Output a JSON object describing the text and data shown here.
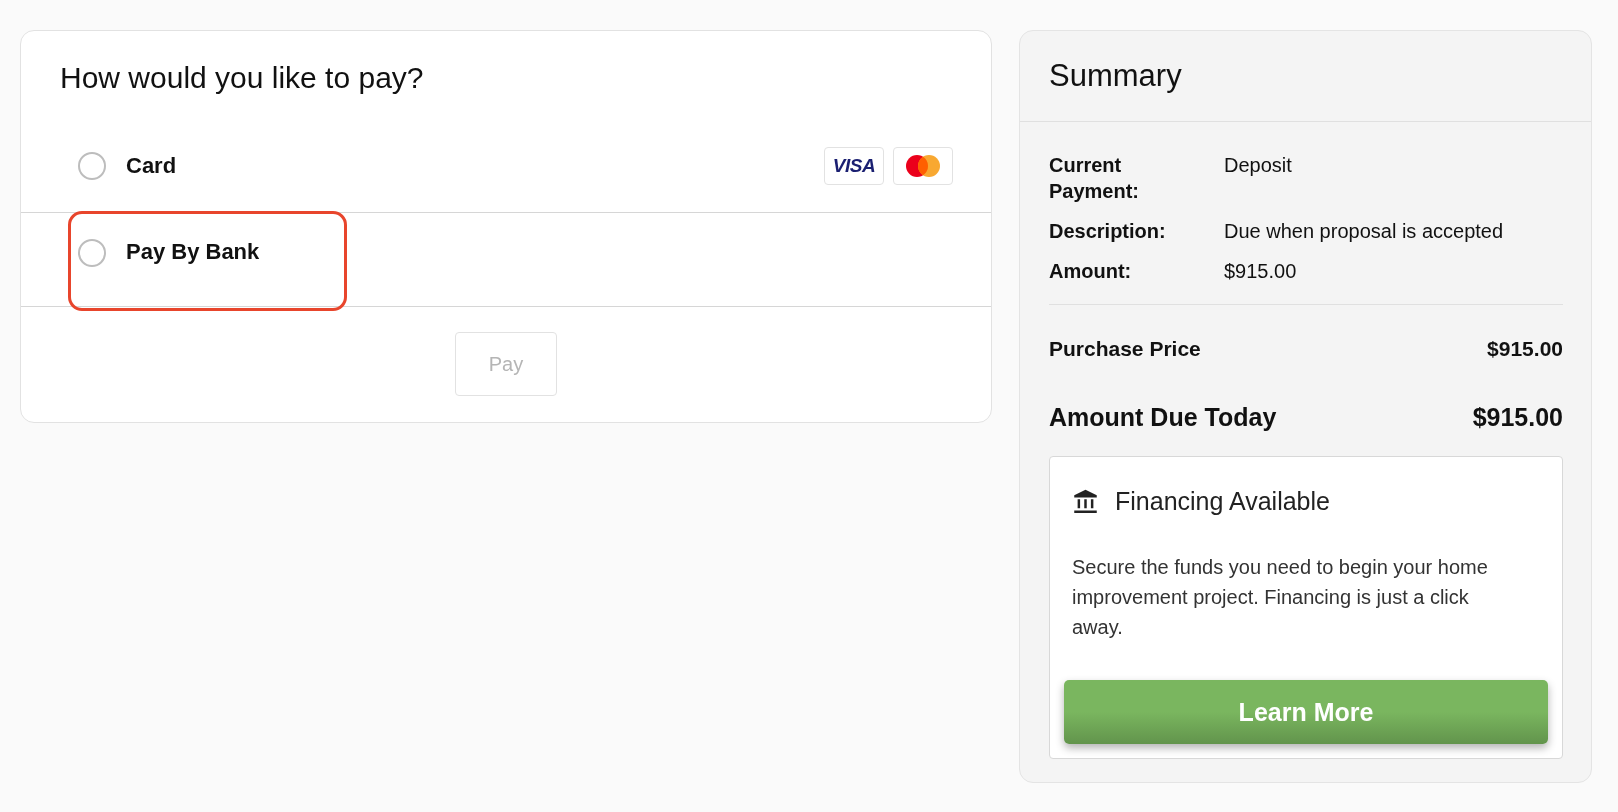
{
  "payment": {
    "title": "How would you like to pay?",
    "options": [
      {
        "kind": "card",
        "label": "Card",
        "selected": false,
        "highlighted": false,
        "brands": [
          {
            "kind": "visa",
            "text": "VISA"
          },
          {
            "kind": "mastercard"
          }
        ]
      },
      {
        "kind": "bank",
        "label": "Pay By Bank",
        "selected": false,
        "highlighted": true
      }
    ],
    "pay_button": {
      "label": "Pay",
      "disabled": true
    }
  },
  "summary": {
    "title": "Summary",
    "details": [
      {
        "label": "Current Payment:",
        "value": "Deposit"
      },
      {
        "label": "Description:",
        "value": "Due when proposal is accepted"
      },
      {
        "label": "Amount:",
        "value": "$915.00"
      }
    ],
    "purchase_price": {
      "label": "Purchase Price",
      "value": "$915.00"
    },
    "amount_due": {
      "label": "Amount Due Today",
      "value": "$915.00"
    },
    "financing": {
      "title": "Financing Available",
      "text": "Secure the funds you need to begin your home improvement project. Financing is just a click away.",
      "button": "Learn More"
    }
  }
}
